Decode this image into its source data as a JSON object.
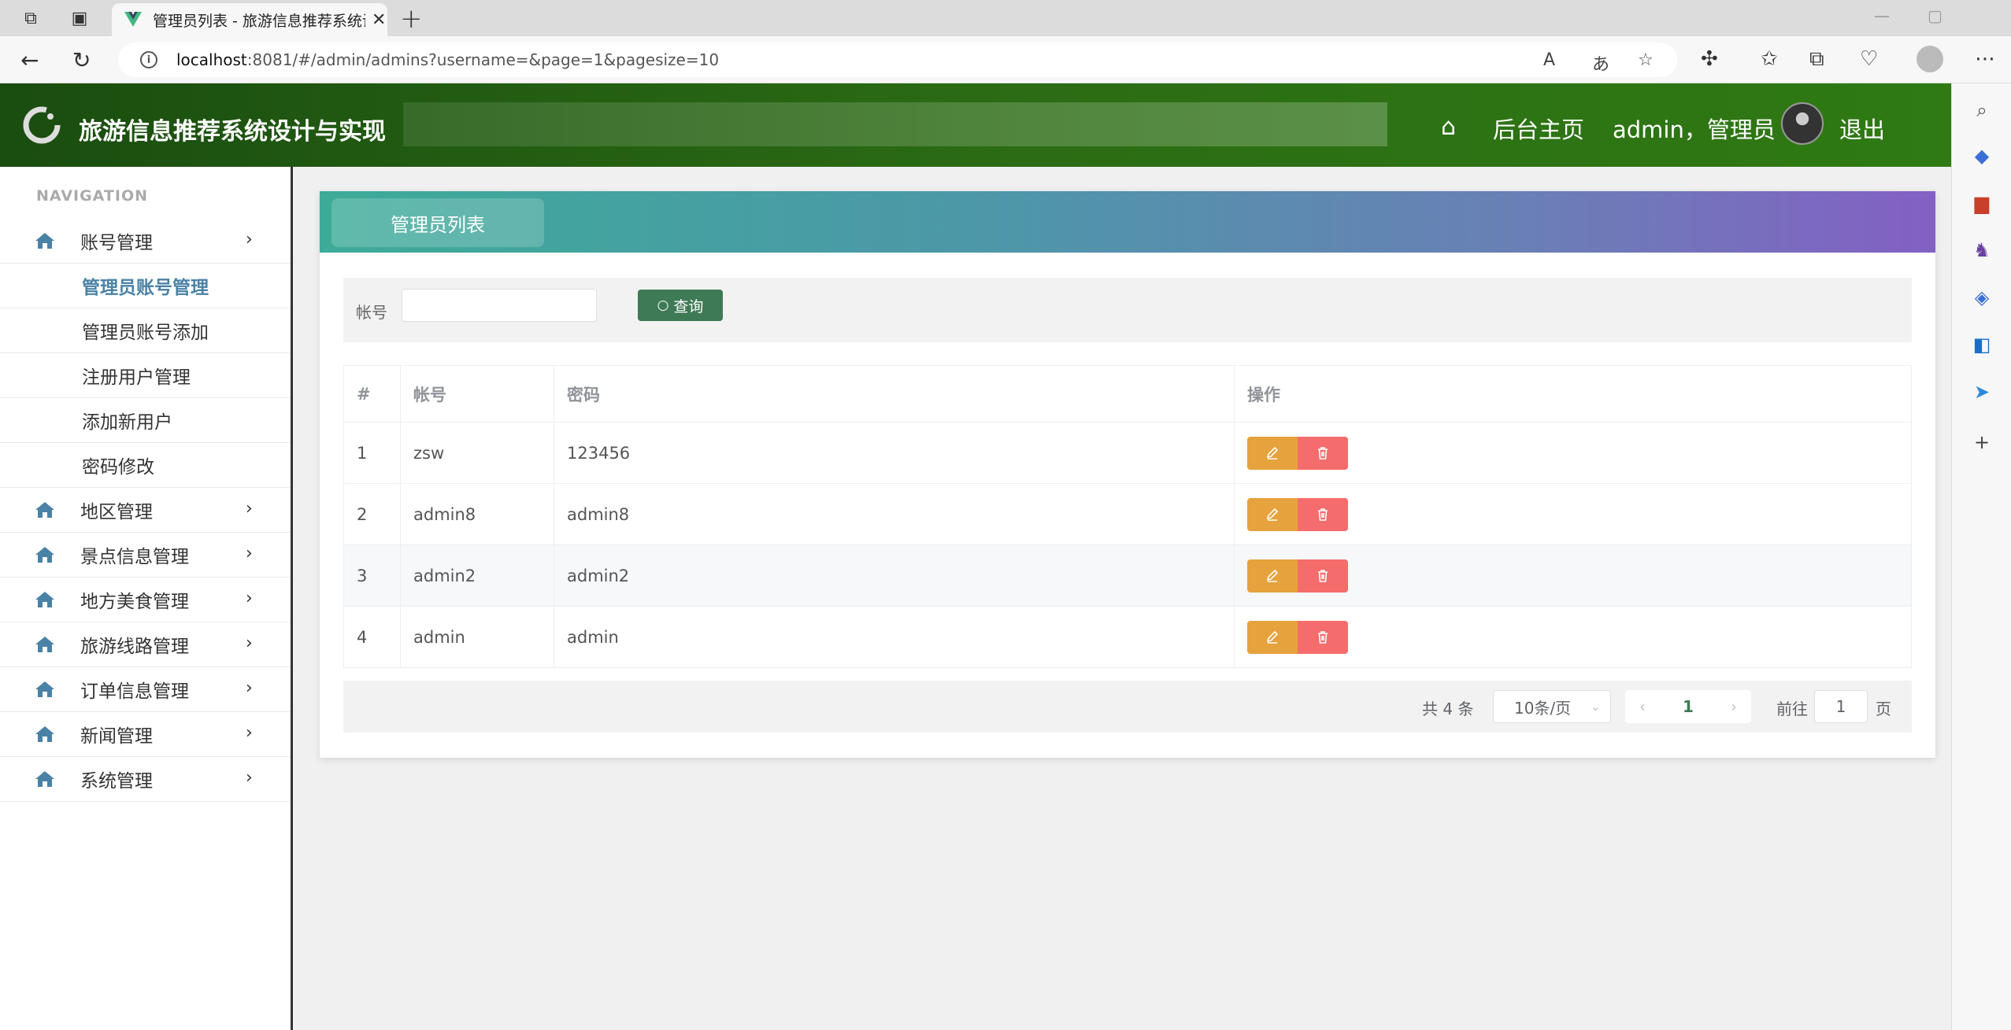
{
  "browser": {
    "tab_title": "管理员列表 - 旅游信息推荐系统设计与实现",
    "url_host": "localhost",
    "url_rest": ":8081/#/admin/admins?username=&page=1&pagesize=10"
  },
  "header": {
    "app_title": "旅游信息推荐系统设计与实现",
    "home_link": "后台主页",
    "user_label": "admin，管理员",
    "logout": "退出"
  },
  "nav": {
    "heading": "NAVIGATION",
    "groups": [
      {
        "label": "账号管理"
      },
      {
        "label": "地区管理"
      },
      {
        "label": "景点信息管理"
      },
      {
        "label": "地方美食管理"
      },
      {
        "label": "旅游线路管理"
      },
      {
        "label": "订单信息管理"
      },
      {
        "label": "新闻管理"
      },
      {
        "label": "系统管理"
      }
    ],
    "sub_items": [
      {
        "label": "管理员账号管理"
      },
      {
        "label": "管理员账号添加"
      },
      {
        "label": "注册用户管理"
      },
      {
        "label": "添加新用户"
      },
      {
        "label": "密码修改"
      }
    ]
  },
  "panel": {
    "tab_title": "管理员列表",
    "search_label": "帐号",
    "search_value": "",
    "search_button": "查询"
  },
  "table": {
    "columns": [
      "#",
      "帐号",
      "密码",
      "操作"
    ],
    "rows": [
      {
        "no": "1",
        "account": "zsw",
        "password": "123456"
      },
      {
        "no": "2",
        "account": "admin8",
        "password": "admin8"
      },
      {
        "no": "3",
        "account": "admin2",
        "password": "admin2"
      },
      {
        "no": "4",
        "account": "admin",
        "password": "admin"
      }
    ]
  },
  "pager": {
    "total": "共 4 条",
    "page_size": "10条/页",
    "current_page": "1",
    "goto_label": "前往",
    "goto_value": "1",
    "page_suffix": "页"
  },
  "colors": {
    "header_green": "#2b6b14",
    "search_button": "#3f7a56",
    "edit_button": "#e6a23c",
    "delete_button": "#f56c6c",
    "active_nav": "#4a82a6"
  }
}
